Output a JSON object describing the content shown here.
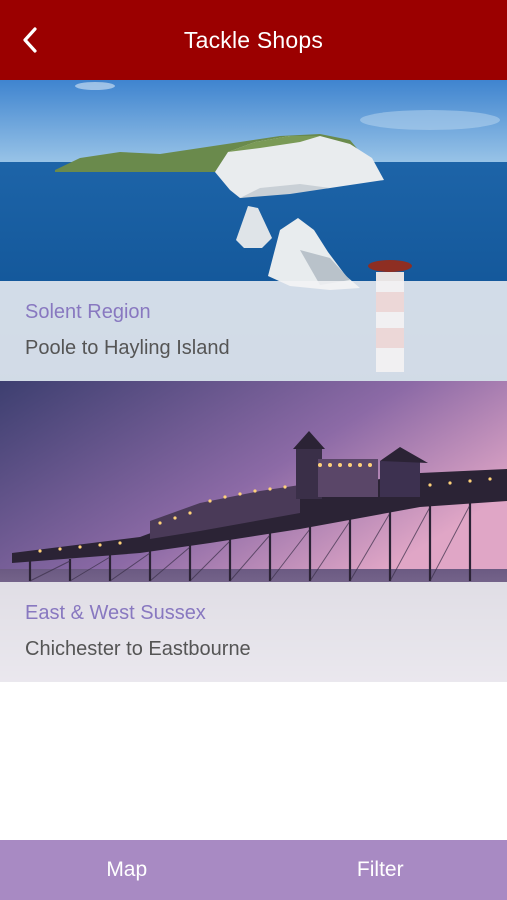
{
  "header": {
    "title": "Tackle Shops",
    "back_icon": "chevron-left-icon",
    "background_color": "#9b0000"
  },
  "regions": [
    {
      "title": "Solent Region",
      "subtitle": "Poole to Hayling Island"
    },
    {
      "title": "East & West Sussex",
      "subtitle": "Chichester to Eastbourne"
    }
  ],
  "bottom_bar": {
    "map_label": "Map",
    "filter_label": "Filter",
    "background_color": "#a88ac3"
  },
  "colors": {
    "region_title": "#8878c0",
    "region_subtitle": "#555555"
  }
}
